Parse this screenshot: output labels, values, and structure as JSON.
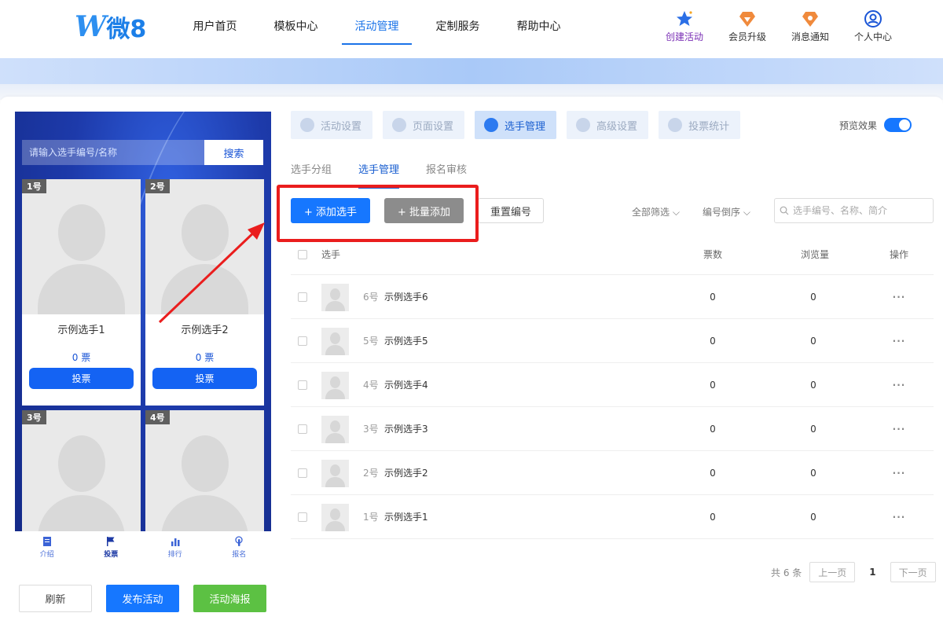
{
  "header": {
    "logo_text": "微8",
    "nav": [
      "用户首页",
      "模板中心",
      "活动管理",
      "定制服务",
      "帮助中心"
    ],
    "actions": [
      "创建活动",
      "会员升级",
      "消息通知",
      "个人中心"
    ],
    "colors": {
      "accent": "#1677ff",
      "create": "#7a2fb5",
      "highlight": "#ea1d1d"
    }
  },
  "preview": {
    "search_placeholder": "请输入选手编号/名称",
    "search_button": "搜索",
    "cards": [
      {
        "badge": "1号",
        "name": "示例选手1",
        "votes": "0 票",
        "vote_button": "投票"
      },
      {
        "badge": "2号",
        "name": "示例选手2",
        "votes": "0 票",
        "vote_button": "投票"
      },
      {
        "badge": "3号"
      },
      {
        "badge": "4号"
      }
    ],
    "tabs": [
      "介绍",
      "投票",
      "排行",
      "报名"
    ],
    "buttons": [
      "刷新",
      "发布活动",
      "活动海报"
    ]
  },
  "steps": [
    "活动设置",
    "页面设置",
    "选手管理",
    "高级设置",
    "投票统计"
  ],
  "preview_toggle_label": "预览效果",
  "subtabs": [
    "选手分组",
    "选手管理",
    "报名审核"
  ],
  "toolbar": {
    "add": "+ 添加选手",
    "batch": "+ 批量添加",
    "reset": "重置编号",
    "filter": "全部筛选",
    "sort": "编号倒序",
    "search_placeholder": "选手编号、名称、简介"
  },
  "table": {
    "headers": {
      "player": "选手",
      "votes": "票数",
      "views": "浏览量",
      "ops": "操作"
    },
    "rows": [
      {
        "num": "6号",
        "name": "示例选手6",
        "votes": "0",
        "views": "0",
        "ops": "···"
      },
      {
        "num": "5号",
        "name": "示例选手5",
        "votes": "0",
        "views": "0",
        "ops": "···"
      },
      {
        "num": "4号",
        "name": "示例选手4",
        "votes": "0",
        "views": "0",
        "ops": "···"
      },
      {
        "num": "3号",
        "name": "示例选手3",
        "votes": "0",
        "views": "0",
        "ops": "···"
      },
      {
        "num": "2号",
        "name": "示例选手2",
        "votes": "0",
        "views": "0",
        "ops": "···"
      },
      {
        "num": "1号",
        "name": "示例选手1",
        "votes": "0",
        "views": "0",
        "ops": "···"
      }
    ]
  },
  "pager": {
    "total": "共 6 条",
    "prev": "上一页",
    "current": "1",
    "next": "下一页"
  }
}
